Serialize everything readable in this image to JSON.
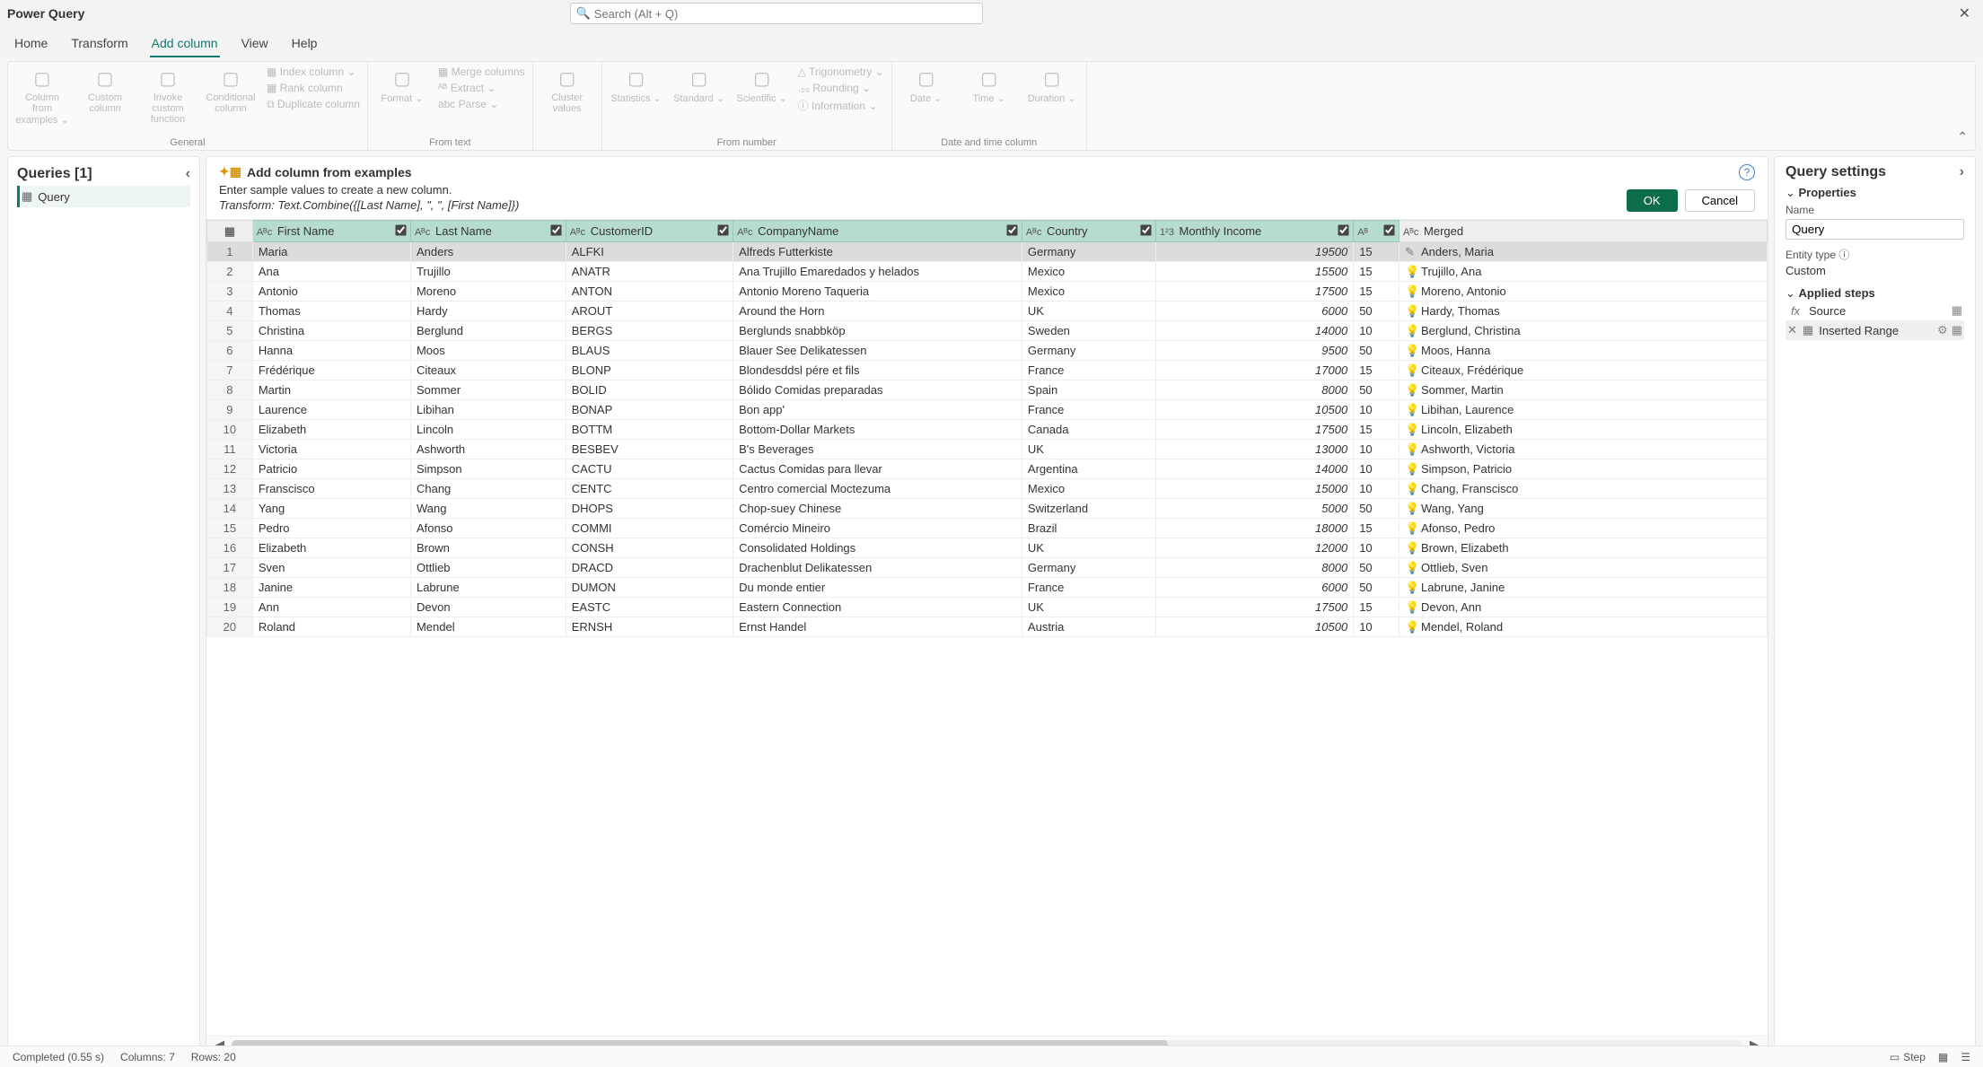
{
  "title": "Power Query",
  "search_placeholder": "Search (Alt + Q)",
  "tabs": [
    "Home",
    "Transform",
    "Add column",
    "View",
    "Help"
  ],
  "active_tab": "Add column",
  "ribbon": {
    "groups": [
      {
        "label": "General",
        "items": [
          "Column from examples ⌄",
          "Custom column",
          "Invoke custom function",
          "Conditional column"
        ],
        "small": [
          "▦ Index column ⌄",
          "▦ Rank column",
          "⧉ Duplicate column"
        ]
      },
      {
        "label": "From text",
        "big": [
          "Format ⌄"
        ],
        "small": [
          "▦ Merge columns",
          "ᴬᴮ Extract ⌄",
          "abc Parse ⌄"
        ]
      },
      {
        "label": "",
        "big": [
          "Cluster values"
        ]
      },
      {
        "label": "From number",
        "big": [
          "Statistics ⌄",
          "Standard ⌄",
          "Scientific ⌄"
        ],
        "small": [
          "△ Trigonometry ⌄",
          ".₀₀ Rounding ⌄",
          "ⓘ Information ⌄"
        ]
      },
      {
        "label": "Date and time column",
        "big": [
          "Date ⌄",
          "Time ⌄",
          "Duration ⌄"
        ]
      }
    ]
  },
  "queries_hdr": "Queries [1]",
  "query_name": "Query",
  "example": {
    "title": "Add column from examples",
    "sub": "Enter sample values to create a new column.",
    "transform": "Transform: Text.Combine({[Last Name], \", \", [First Name]})",
    "ok": "OK",
    "cancel": "Cancel"
  },
  "columns": [
    "First Name",
    "Last Name",
    "CustomerID",
    "CompanyName",
    "Country",
    "Monthly Income",
    "",
    "Merged"
  ],
  "col_type_icons": [
    "Aᴮc",
    "Aᴮc",
    "Aᴮc",
    "Aᴮc",
    "Aᴮc",
    "1²3",
    "Aᴮ",
    "Aᴮc"
  ],
  "rows": [
    {
      "n": 1,
      "c": [
        "Maria",
        "Anders",
        "ALFKI",
        "Alfreds Futterkiste",
        "Germany",
        "19500",
        "15",
        "Anders, Maria"
      ],
      "edit": true
    },
    {
      "n": 2,
      "c": [
        "Ana",
        "Trujillo",
        "ANATR",
        "Ana Trujillo Emaredados y helados",
        "Mexico",
        "15500",
        "15",
        "Trujillo, Ana"
      ]
    },
    {
      "n": 3,
      "c": [
        "Antonio",
        "Moreno",
        "ANTON",
        "Antonio Moreno Taqueria",
        "Mexico",
        "17500",
        "15",
        "Moreno, Antonio"
      ]
    },
    {
      "n": 4,
      "c": [
        "Thomas",
        "Hardy",
        "AROUT",
        "Around the Horn",
        "UK",
        "6000",
        "50",
        "Hardy, Thomas"
      ]
    },
    {
      "n": 5,
      "c": [
        "Christina",
        "Berglund",
        "BERGS",
        "Berglunds snabbköp",
        "Sweden",
        "14000",
        "10",
        "Berglund, Christina"
      ]
    },
    {
      "n": 6,
      "c": [
        "Hanna",
        "Moos",
        "BLAUS",
        "Blauer See Delikatessen",
        "Germany",
        "9500",
        "50",
        "Moos, Hanna"
      ]
    },
    {
      "n": 7,
      "c": [
        "Frédérique",
        "Citeaux",
        "BLONP",
        "Blondesddsl pére et fils",
        "France",
        "17000",
        "15",
        "Citeaux, Frédérique"
      ]
    },
    {
      "n": 8,
      "c": [
        "Martin",
        "Sommer",
        "BOLID",
        "Bólido Comidas preparadas",
        "Spain",
        "8000",
        "50",
        "Sommer, Martin"
      ]
    },
    {
      "n": 9,
      "c": [
        "Laurence",
        "Libihan",
        "BONAP",
        "Bon app'",
        "France",
        "10500",
        "10",
        "Libihan, Laurence"
      ]
    },
    {
      "n": 10,
      "c": [
        "Elizabeth",
        "Lincoln",
        "BOTTM",
        "Bottom-Dollar Markets",
        "Canada",
        "17500",
        "15",
        "Lincoln, Elizabeth"
      ]
    },
    {
      "n": 11,
      "c": [
        "Victoria",
        "Ashworth",
        "BESBEV",
        "B's Beverages",
        "UK",
        "13000",
        "10",
        "Ashworth, Victoria"
      ]
    },
    {
      "n": 12,
      "c": [
        "Patricio",
        "Simpson",
        "CACTU",
        "Cactus Comidas para llevar",
        "Argentina",
        "14000",
        "10",
        "Simpson, Patricio"
      ]
    },
    {
      "n": 13,
      "c": [
        "Franscisco",
        "Chang",
        "CENTC",
        "Centro comercial Moctezuma",
        "Mexico",
        "15000",
        "10",
        "Chang, Franscisco"
      ]
    },
    {
      "n": 14,
      "c": [
        "Yang",
        "Wang",
        "DHOPS",
        "Chop-suey Chinese",
        "Switzerland",
        "5000",
        "50",
        "Wang, Yang"
      ]
    },
    {
      "n": 15,
      "c": [
        "Pedro",
        "Afonso",
        "COMMI",
        "Comércio Mineiro",
        "Brazil",
        "18000",
        "15",
        "Afonso, Pedro"
      ]
    },
    {
      "n": 16,
      "c": [
        "Elizabeth",
        "Brown",
        "CONSH",
        "Consolidated Holdings",
        "UK",
        "12000",
        "10",
        "Brown, Elizabeth"
      ]
    },
    {
      "n": 17,
      "c": [
        "Sven",
        "Ottlieb",
        "DRACD",
        "Drachenblut Delikatessen",
        "Germany",
        "8000",
        "50",
        "Ottlieb, Sven"
      ]
    },
    {
      "n": 18,
      "c": [
        "Janine",
        "Labrune",
        "DUMON",
        "Du monde entier",
        "France",
        "6000",
        "50",
        "Labrune, Janine"
      ]
    },
    {
      "n": 19,
      "c": [
        "Ann",
        "Devon",
        "EASTC",
        "Eastern Connection",
        "UK",
        "17500",
        "15",
        "Devon, Ann"
      ]
    },
    {
      "n": 20,
      "c": [
        "Roland",
        "Mendel",
        "ERNSH",
        "Ernst Handel",
        "Austria",
        "10500",
        "10",
        "Mendel, Roland"
      ]
    }
  ],
  "settings": {
    "title": "Query settings",
    "properties": "Properties",
    "name_label": "Name",
    "name_value": "Query",
    "entity_label": "Entity type ⓘ",
    "entity_value": "Custom",
    "applied": "Applied steps",
    "steps": [
      {
        "label": "Source",
        "fx": "fx",
        "right": [
          "▦"
        ]
      },
      {
        "label": "Inserted Range",
        "ico": "▦",
        "del": "✕",
        "sel": true,
        "right": [
          "⚙",
          "▦"
        ]
      }
    ]
  },
  "status": {
    "completed": "Completed (0.55 s)",
    "cols": "Columns: 7",
    "rows": "Rows: 20",
    "step": "Step"
  }
}
